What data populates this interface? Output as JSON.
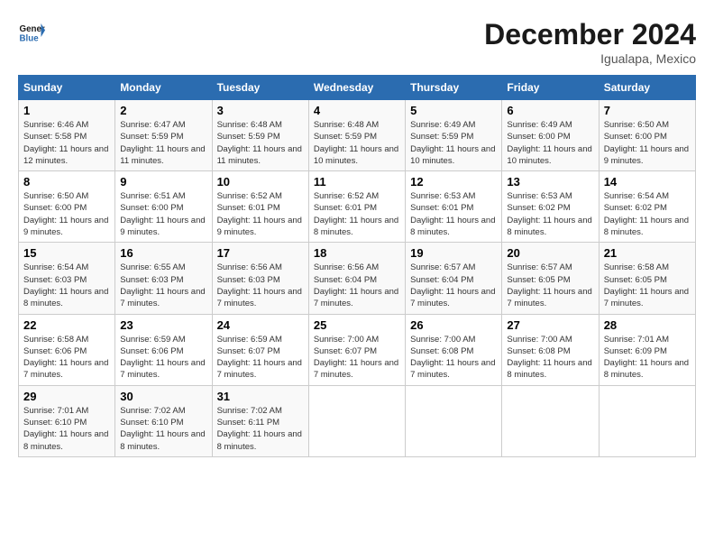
{
  "logo": {
    "line1": "General",
    "line2": "Blue"
  },
  "title": "December 2024",
  "location": "Igualapa, Mexico",
  "days_of_week": [
    "Sunday",
    "Monday",
    "Tuesday",
    "Wednesday",
    "Thursday",
    "Friday",
    "Saturday"
  ],
  "weeks": [
    [
      {
        "num": "1",
        "sunrise": "6:46 AM",
        "sunset": "5:58 PM",
        "daylight": "11 hours and 12 minutes."
      },
      {
        "num": "2",
        "sunrise": "6:47 AM",
        "sunset": "5:59 PM",
        "daylight": "11 hours and 11 minutes."
      },
      {
        "num": "3",
        "sunrise": "6:48 AM",
        "sunset": "5:59 PM",
        "daylight": "11 hours and 11 minutes."
      },
      {
        "num": "4",
        "sunrise": "6:48 AM",
        "sunset": "5:59 PM",
        "daylight": "11 hours and 10 minutes."
      },
      {
        "num": "5",
        "sunrise": "6:49 AM",
        "sunset": "5:59 PM",
        "daylight": "11 hours and 10 minutes."
      },
      {
        "num": "6",
        "sunrise": "6:49 AM",
        "sunset": "6:00 PM",
        "daylight": "11 hours and 10 minutes."
      },
      {
        "num": "7",
        "sunrise": "6:50 AM",
        "sunset": "6:00 PM",
        "daylight": "11 hours and 9 minutes."
      }
    ],
    [
      {
        "num": "8",
        "sunrise": "6:50 AM",
        "sunset": "6:00 PM",
        "daylight": "11 hours and 9 minutes."
      },
      {
        "num": "9",
        "sunrise": "6:51 AM",
        "sunset": "6:00 PM",
        "daylight": "11 hours and 9 minutes."
      },
      {
        "num": "10",
        "sunrise": "6:52 AM",
        "sunset": "6:01 PM",
        "daylight": "11 hours and 9 minutes."
      },
      {
        "num": "11",
        "sunrise": "6:52 AM",
        "sunset": "6:01 PM",
        "daylight": "11 hours and 8 minutes."
      },
      {
        "num": "12",
        "sunrise": "6:53 AM",
        "sunset": "6:01 PM",
        "daylight": "11 hours and 8 minutes."
      },
      {
        "num": "13",
        "sunrise": "6:53 AM",
        "sunset": "6:02 PM",
        "daylight": "11 hours and 8 minutes."
      },
      {
        "num": "14",
        "sunrise": "6:54 AM",
        "sunset": "6:02 PM",
        "daylight": "11 hours and 8 minutes."
      }
    ],
    [
      {
        "num": "15",
        "sunrise": "6:54 AM",
        "sunset": "6:03 PM",
        "daylight": "11 hours and 8 minutes."
      },
      {
        "num": "16",
        "sunrise": "6:55 AM",
        "sunset": "6:03 PM",
        "daylight": "11 hours and 7 minutes."
      },
      {
        "num": "17",
        "sunrise": "6:56 AM",
        "sunset": "6:03 PM",
        "daylight": "11 hours and 7 minutes."
      },
      {
        "num": "18",
        "sunrise": "6:56 AM",
        "sunset": "6:04 PM",
        "daylight": "11 hours and 7 minutes."
      },
      {
        "num": "19",
        "sunrise": "6:57 AM",
        "sunset": "6:04 PM",
        "daylight": "11 hours and 7 minutes."
      },
      {
        "num": "20",
        "sunrise": "6:57 AM",
        "sunset": "6:05 PM",
        "daylight": "11 hours and 7 minutes."
      },
      {
        "num": "21",
        "sunrise": "6:58 AM",
        "sunset": "6:05 PM",
        "daylight": "11 hours and 7 minutes."
      }
    ],
    [
      {
        "num": "22",
        "sunrise": "6:58 AM",
        "sunset": "6:06 PM",
        "daylight": "11 hours and 7 minutes."
      },
      {
        "num": "23",
        "sunrise": "6:59 AM",
        "sunset": "6:06 PM",
        "daylight": "11 hours and 7 minutes."
      },
      {
        "num": "24",
        "sunrise": "6:59 AM",
        "sunset": "6:07 PM",
        "daylight": "11 hours and 7 minutes."
      },
      {
        "num": "25",
        "sunrise": "7:00 AM",
        "sunset": "6:07 PM",
        "daylight": "11 hours and 7 minutes."
      },
      {
        "num": "26",
        "sunrise": "7:00 AM",
        "sunset": "6:08 PM",
        "daylight": "11 hours and 7 minutes."
      },
      {
        "num": "27",
        "sunrise": "7:00 AM",
        "sunset": "6:08 PM",
        "daylight": "11 hours and 8 minutes."
      },
      {
        "num": "28",
        "sunrise": "7:01 AM",
        "sunset": "6:09 PM",
        "daylight": "11 hours and 8 minutes."
      }
    ],
    [
      {
        "num": "29",
        "sunrise": "7:01 AM",
        "sunset": "6:10 PM",
        "daylight": "11 hours and 8 minutes."
      },
      {
        "num": "30",
        "sunrise": "7:02 AM",
        "sunset": "6:10 PM",
        "daylight": "11 hours and 8 minutes."
      },
      {
        "num": "31",
        "sunrise": "7:02 AM",
        "sunset": "6:11 PM",
        "daylight": "11 hours and 8 minutes."
      },
      null,
      null,
      null,
      null
    ]
  ]
}
